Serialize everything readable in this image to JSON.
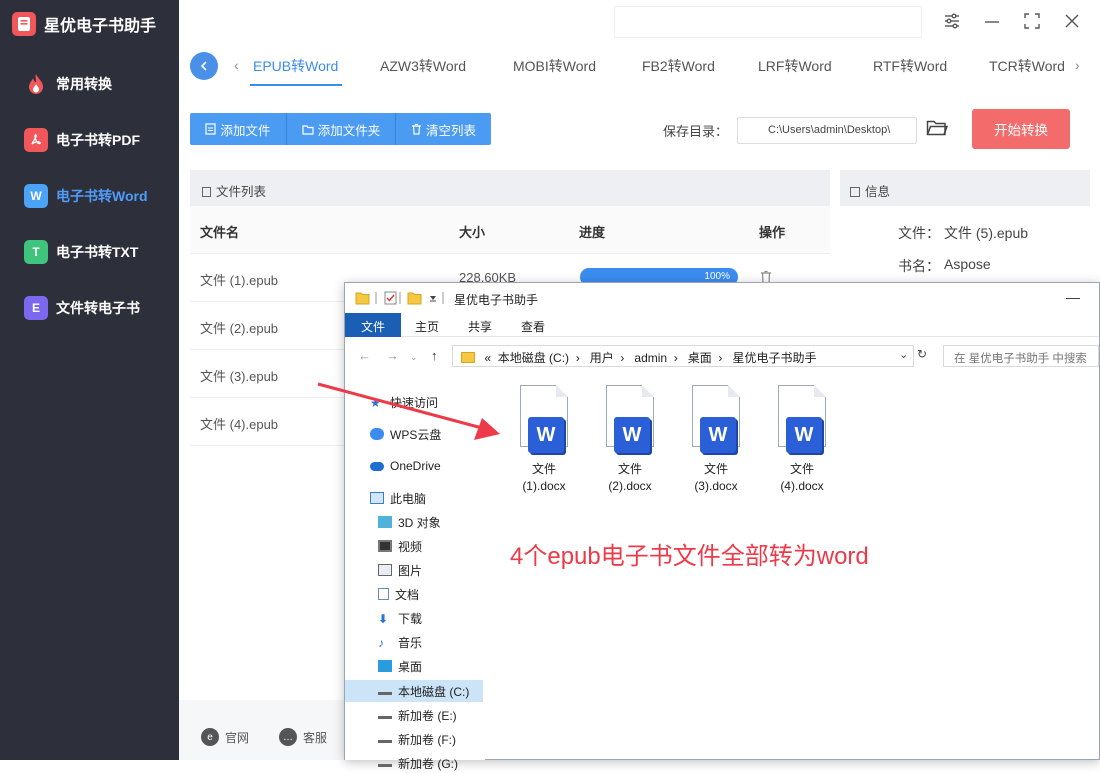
{
  "app": {
    "title": "星优电子书助手",
    "nav": [
      {
        "label": "常用转换",
        "icon": "flame-icon",
        "color": "#f0565a"
      },
      {
        "label": "电子书转PDF",
        "icon": "pdf-icon",
        "color": "#f0565a"
      },
      {
        "label": "电子书转Word",
        "icon": "word-icon",
        "color": "#4aa3f7",
        "active": true
      },
      {
        "label": "电子书转TXT",
        "icon": "txt-icon",
        "color": "#3ec47c"
      },
      {
        "label": "文件转电子书",
        "icon": "ebook-icon",
        "color": "#7b68ee"
      }
    ],
    "nav_letters": [
      "",
      "",
      "W",
      "T",
      "E"
    ],
    "tabs": [
      "EPUB转Word",
      "AZW3转Word",
      "MOBI转Word",
      "FB2转Word",
      "LRF转Word",
      "RTF转Word",
      "TCR转Word"
    ],
    "toolbar": {
      "add_file": "添加文件",
      "add_folder": "添加文件夹",
      "clear_list": "清空列表"
    },
    "save": {
      "label": "保存目录：",
      "path": "C:\\Users\\admin\\Desktop\\"
    },
    "start_button": "开始转换",
    "file_list": {
      "title": "文件列表",
      "headers": {
        "name": "文件名",
        "size": "大小",
        "progress": "进度",
        "action": "操作"
      },
      "rows": [
        {
          "name": "文件 (1).epub",
          "size": "228.60KB",
          "progress": "100%"
        },
        {
          "name": "文件 (2).epub"
        },
        {
          "name": "文件 (3).epub"
        },
        {
          "name": "文件 (4).epub"
        }
      ]
    },
    "info": {
      "title": "信息",
      "file_label": "文件：",
      "file_value": "文件 (5).epub",
      "book_label": "书名：",
      "book_value": "Aspose"
    },
    "footer": {
      "website": "官网",
      "service": "客服"
    }
  },
  "explorer": {
    "title": "星优电子书助手",
    "ribbon": [
      "文件",
      "主页",
      "共享",
      "查看"
    ],
    "address": [
      "本地磁盘 (C:)",
      "用户",
      "admin",
      "桌面",
      "星优电子书助手"
    ],
    "address_prefix": "«",
    "search_placeholder": "在 星优电子书助手 中搜索",
    "tree": [
      "快速访问",
      "WPS云盘",
      "OneDrive",
      "此电脑",
      "3D 对象",
      "视频",
      "图片",
      "文档",
      "下载",
      "音乐",
      "桌面",
      "本地磁盘 (C:)",
      "新加卷 (E:)",
      "新加卷 (F:)",
      "新加卷 (G:)"
    ],
    "files": [
      {
        "line1": "文件",
        "line2": "(1).docx"
      },
      {
        "line1": "文件",
        "line2": "(2).docx"
      },
      {
        "line1": "文件",
        "line2": "(3).docx"
      },
      {
        "line1": "文件",
        "line2": "(4).docx"
      }
    ],
    "badge_letter": "W"
  },
  "annotation": "4个epub电子书文件全部转为word",
  "colors": {
    "accent": "#3b8cf0",
    "start": "#f46b6b",
    "annotation": "#ee3a48"
  }
}
